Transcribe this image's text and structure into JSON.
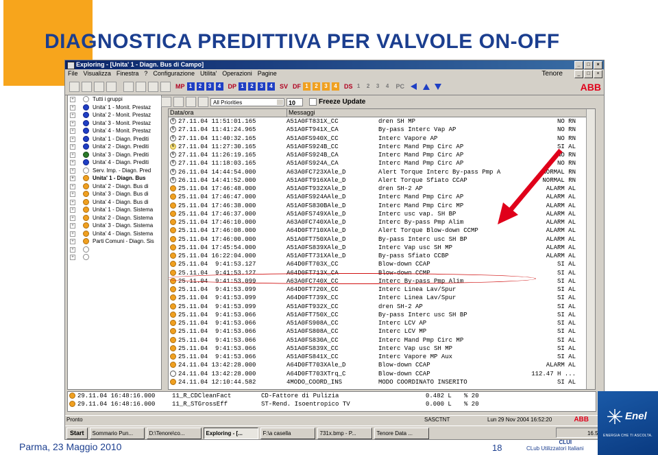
{
  "slide": {
    "title": "DIAGNOSTICA PREDITTIVA PER VALVOLE ON-OFF",
    "footer_left": "Parma, 23 Maggio 2010",
    "page_number": "18",
    "logo_enel": "Enel",
    "logo_enel_sub": "ENERGIA CHE TI ASCOLTA.",
    "logo_clui_top": "CLUI",
    "logo_clui_bottom": "CLub Utilizzatori Italiani",
    "colors": {
      "title": "#1b3e8f",
      "orange_block": "#f7a51c",
      "highlight": "#d01010",
      "arrow": "#e0001a"
    }
  },
  "window": {
    "title": "Exploring - [Unita' 1 - Diagn. Bus di Campo]",
    "station": "Tenore",
    "brand": "ABB",
    "menu": [
      "File",
      "Visualizza",
      "Finestra",
      "?",
      "Configurazione",
      "Utilita'",
      "Operazioni",
      "Pagine"
    ],
    "toolbar_groups": [
      {
        "label": "MP",
        "buttons": [
          "1",
          "2",
          "3",
          "4"
        ]
      },
      {
        "label": "DP",
        "buttons": [
          "1",
          "2",
          "3",
          "4"
        ]
      },
      {
        "label": "SV",
        "buttons": []
      },
      {
        "label": "DF",
        "buttons": [
          "1",
          "2",
          "3",
          "4"
        ]
      },
      {
        "label": "DS",
        "buttons": [
          "1",
          "2",
          "3",
          "4"
        ]
      },
      {
        "label": "PC",
        "buttons": []
      }
    ],
    "priority_select": "All Priorities",
    "page_size": "10",
    "freeze_label": "Freeze Update"
  },
  "tree": [
    {
      "label": "Tutti i gruppi",
      "icon": "empty",
      "bold": false
    },
    {
      "label": "Unita' 1 - Monit. Prestaz",
      "icon": "blue",
      "bold": false
    },
    {
      "label": "Unita' 2 - Monit. Prestaz",
      "icon": "blue",
      "bold": false
    },
    {
      "label": "Unita' 3 - Monit. Prestaz",
      "icon": "blue",
      "bold": false
    },
    {
      "label": "Unita' 4 - Monit. Prestaz",
      "icon": "blue",
      "bold": false
    },
    {
      "label": "Unita' 1 - Diagn. Prediti",
      "icon": "blue",
      "bold": false
    },
    {
      "label": "Unita' 2 - Diagn. Prediti",
      "icon": "blue",
      "bold": false
    },
    {
      "label": "Unita' 3 - Diagn. Prediti",
      "icon": "green",
      "bold": false
    },
    {
      "label": "Unita' 4 - Diagn. Prediti",
      "icon": "blue",
      "bold": false
    },
    {
      "label": "Serv. Imp. - Diagn. Pred",
      "icon": "empty",
      "bold": false
    },
    {
      "label": "Unita' 1 - Diagn. Bus",
      "icon": "orange",
      "bold": true
    },
    {
      "label": "Unita' 2 - Diagn. Bus di",
      "icon": "orange",
      "bold": false
    },
    {
      "label": "Unita' 3 - Diagn. Bus di",
      "icon": "orange",
      "bold": false
    },
    {
      "label": "Unita' 4 - Diagn. Bus di",
      "icon": "orange",
      "bold": false
    },
    {
      "label": "Unita' 1 - Diagn. Sistema",
      "icon": "orange",
      "bold": false
    },
    {
      "label": "Unita' 2 - Diagn. Sistema",
      "icon": "orange",
      "bold": false
    },
    {
      "label": "Unita' 3 - Diagn. Sistema",
      "icon": "orange",
      "bold": false
    },
    {
      "label": "Unita' 4 - Diagn. Sistema",
      "icon": "orange",
      "bold": false
    },
    {
      "label": "Parti Comuni - Diagn. Sis",
      "icon": "orange",
      "bold": false
    },
    {
      "label": "",
      "icon": "empty",
      "bold": false
    },
    {
      "label": "",
      "icon": "empty",
      "bold": false
    }
  ],
  "grid": {
    "col_date": "Data/ora",
    "col_msg": "Messaggi",
    "rows": [
      {
        "icon": "6",
        "date": "27.11.04",
        "time": "11:51:01.165",
        "tag": "A51A0FT831X_CC",
        "text": "dren SH MP",
        "status": "NO RN"
      },
      {
        "icon": "6",
        "date": "27.11.04",
        "time": "11:41:24.965",
        "tag": "A51A0FT941X_CA",
        "text": "By-pass Interc Vap AP",
        "status": "NO RN"
      },
      {
        "icon": "6",
        "date": "27.11.04",
        "time": "11:40:32.165",
        "tag": "A51A0FS940X_CC",
        "text": "Interc Vapore AP",
        "status": "NO RN"
      },
      {
        "icon": "6y",
        "date": "27.11.04",
        "time": "11:27:30.165",
        "tag": "A51A0FS924B_CC",
        "text": "Interc Mand Pmp Circ AP",
        "status": "SI AL"
      },
      {
        "icon": "6",
        "date": "27.11.04",
        "time": "11:26:19.165",
        "tag": "A51A0FS924B_CA",
        "text": "Interc Mand Pmp Circ AP",
        "status": "NO RN"
      },
      {
        "icon": "6",
        "date": "27.11.04",
        "time": "11:18:03.165",
        "tag": "A51A0FS924A_CA",
        "text": "Interc Mand Pmp Circ AP",
        "status": "NO RN"
      },
      {
        "icon": "6",
        "date": "26.11.04",
        "time": "14:44:54.000",
        "tag": "A63A0FC723XAle_D",
        "text": "Alert Torque Interc By-pass Pmp A",
        "status": "NORMAL RN"
      },
      {
        "icon": "6",
        "date": "26.11.04",
        "time": "14:41:52.000",
        "tag": "A51A0FT916XAle_D",
        "text": "Alert Torque Sfiato CCAP",
        "status": "NORMAL RN"
      },
      {
        "icon": "o",
        "date": "25.11.04",
        "time": "17:46:48.000",
        "tag": "A51A0FT932XAle_D",
        "text": "dren SH-2 AP",
        "status": "ALARM AL"
      },
      {
        "icon": "o",
        "date": "25.11.04",
        "time": "17:46:47.000",
        "tag": "A51A0FS924AAle_D",
        "text": "Interc Mand Pmp Circ AP",
        "status": "ALARM AL"
      },
      {
        "icon": "o",
        "date": "25.11.04",
        "time": "17:46:38.000",
        "tag": "A51A0FS830BAle_D",
        "text": "Interc Mand Pmp Circ MP",
        "status": "ALARM AL"
      },
      {
        "icon": "o",
        "date": "25.11.04",
        "time": "17:46:37.000",
        "tag": "A51A0FS749XAle_D",
        "text": "Interc usc vap. SH BP",
        "status": "ALARM AL"
      },
      {
        "icon": "o",
        "date": "25.11.04",
        "time": "17:46:10.000",
        "tag": "A63A0FC740XAle_D",
        "text": "Interc By-pass Pmp Alim",
        "status": "ALARM AL"
      },
      {
        "icon": "o",
        "date": "25.11.04",
        "time": "17:46:08.000",
        "tag": "A64D0FT710XAle_D",
        "text": "Alert Torque Blow-down CCMP",
        "status": "ALARM AL"
      },
      {
        "icon": "o",
        "date": "25.11.04",
        "time": "17:46:00.000",
        "tag": "A51A0FT750XAle_D",
        "text": "By-pass Interc usc SH BP",
        "status": "ALARM AL"
      },
      {
        "icon": "o",
        "date": "25.11.04",
        "time": "17:45:54.000",
        "tag": "A51A0FS839XAle_D",
        "text": "Interc Vap usc SH MP",
        "status": "ALARM AL"
      },
      {
        "icon": "o",
        "date": "25.11.04",
        "time": "16:22:04.000",
        "tag": "A51A0FT731XAle_D",
        "text": "By-pass Sfiato CCBP",
        "status": "ALARM AL"
      },
      {
        "icon": "o",
        "date": "25.11.04",
        "time": " 9:41:53.127",
        "tag": "A64D0FT703X_CC",
        "text": "Blow-down CCAP",
        "status": "SI AL"
      },
      {
        "icon": "o",
        "date": "25.11.04",
        "time": " 9:41:53.127",
        "tag": "A64D0FT713X_CA",
        "text": "Blow-down CCMP",
        "status": "SI AL"
      },
      {
        "icon": "o",
        "date": "25.11.04",
        "time": " 9:41:53.099",
        "tag": "A63A0FC740X_CC",
        "text": "Interc By-pass Pmp Alim",
        "status": "SI AL"
      },
      {
        "icon": "o",
        "date": "25.11.04",
        "time": " 9:41:53.099",
        "tag": "A64D0FT720X_CC",
        "text": "Interc Linea Lav/Spur",
        "status": "SI AL"
      },
      {
        "icon": "o",
        "date": "25.11.04",
        "time": " 9:41:53.099",
        "tag": "A64D0FT739X_CC",
        "text": "Interc Linea Lav/Spur",
        "status": "SI AL"
      },
      {
        "icon": "o",
        "date": "25.11.04",
        "time": " 9:41:53.099",
        "tag": "A51A0FT932X_CC",
        "text": "dren SH-2 AP",
        "status": "SI AL"
      },
      {
        "icon": "o",
        "date": "25.11.04",
        "time": " 9:41:53.066",
        "tag": "A51A0FT750X_CC",
        "text": "By-pass Interc usc SH BP",
        "status": "SI AL"
      },
      {
        "icon": "o",
        "date": "25.11.04",
        "time": " 9:41:53.066",
        "tag": "A51A0FS908A_CC",
        "text": "Interc LCV AP",
        "status": "SI AL"
      },
      {
        "icon": "o",
        "date": "25.11.04",
        "time": " 9:41:53.066",
        "tag": "A51A0FS808A_CC",
        "text": "Interc LCV MP",
        "status": "SI AL"
      },
      {
        "icon": "o",
        "date": "25.11.04",
        "time": " 9:41:53.066",
        "tag": "A51A0FS830A_CC",
        "text": "Interc Mand Pmp Circ MP",
        "status": "SI AL"
      },
      {
        "icon": "o",
        "date": "25.11.04",
        "time": " 9:41:53.066",
        "tag": "A51A0FS839X_CC",
        "text": "Interc Vap usc SH MP",
        "status": "SI AL"
      },
      {
        "icon": "o",
        "date": "25.11.04",
        "time": " 9:41:53.066",
        "tag": "A51A0FS841X_CC",
        "text": "Interc Vapore MP Aux",
        "status": "SI AL"
      },
      {
        "icon": "o",
        "date": "24.11.04",
        "time": "13:42:28.000",
        "tag": "A64D0FT703XAle_D",
        "text": "Blow-down CCAP",
        "status": "ALARM AL"
      },
      {
        "icon": "e",
        "date": "24.11.04",
        "time": "13:42:28.000",
        "tag": "A64D0FT703XTrq_C",
        "text": "Blow-down CCAP",
        "status": "112.47 H ..."
      },
      {
        "icon": "o",
        "date": "24.11.04",
        "time": "12:10:44.582",
        "tag": "4MODO_COORD_INS",
        "text": "MODO COORDINATO INSERITO",
        "status": "SI AL"
      }
    ]
  },
  "bottom_rows": [
    {
      "date": "29.11.04",
      "time": "16:48:16.000",
      "tag": "11_R_CDCleanFact",
      "text": "CD-Fattore di Pulizia",
      "value": "0.482 L",
      "unit": "% 20"
    },
    {
      "date": "29.11.04",
      "time": "16:48:16.000",
      "tag": "11_R_STGrossEff",
      "text": "ST-Rend. Isoentropico TV",
      "value": "0.000 L",
      "unit": "% 20"
    }
  ],
  "statusbar": {
    "left": "Pronto",
    "middle": "SASCTNT",
    "datetime": "Lun 29 Nov 2004 16:52:20",
    "brand": "ABB"
  },
  "taskbar": {
    "start": "Start",
    "items": [
      "Sommario Pun...",
      "D:\\Tenore\\co...",
      "Exploring - [...",
      "F:\\a casella",
      "731x.bmp - P...",
      "Tenore Data ..."
    ],
    "active_index": 2,
    "clock": "16.52"
  }
}
